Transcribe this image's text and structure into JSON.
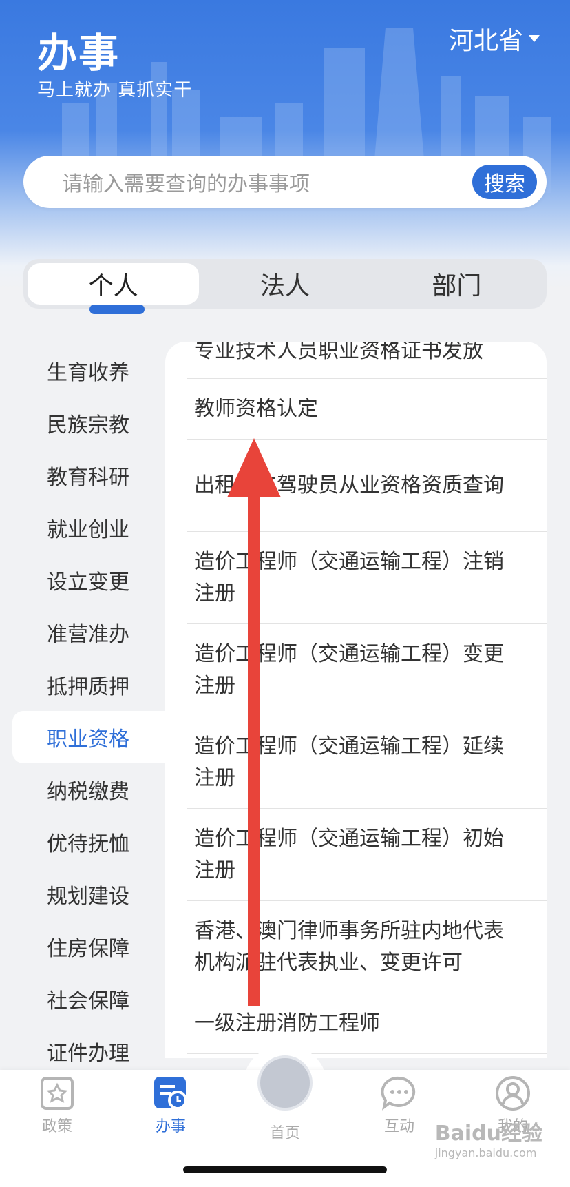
{
  "header": {
    "title": "办事",
    "slogan": "马上就办  真抓实干",
    "province": "河北省"
  },
  "search": {
    "placeholder": "请输入需要查询的办事事项",
    "button": "搜索"
  },
  "tabs": [
    {
      "label": "个人",
      "active": true
    },
    {
      "label": "法人",
      "active": false
    },
    {
      "label": "部门",
      "active": false
    }
  ],
  "sidebar": {
    "items": [
      {
        "label": "生育收养"
      },
      {
        "label": "民族宗教"
      },
      {
        "label": "教育科研"
      },
      {
        "label": "就业创业"
      },
      {
        "label": "设立变更"
      },
      {
        "label": "准营准办"
      },
      {
        "label": "抵押质押"
      },
      {
        "label": "职业资格",
        "active": true
      },
      {
        "label": "纳税缴费"
      },
      {
        "label": "优待抚恤"
      },
      {
        "label": "规划建设"
      },
      {
        "label": "住房保障"
      },
      {
        "label": "社会保障"
      },
      {
        "label": "证件办理"
      }
    ]
  },
  "content": {
    "items": [
      {
        "label": "专业技术人员职业资格证书发放"
      },
      {
        "label": "教师资格认定"
      },
      {
        "label": "出租汽车驾驶员从业资格资质查询"
      },
      {
        "label": "造价工程师（交通运输工程）注销注册"
      },
      {
        "label": "造价工程师（交通运输工程）变更注册"
      },
      {
        "label": "造价工程师（交通运输工程）延续注册"
      },
      {
        "label": "造价工程师（交通运输工程）初始注册"
      },
      {
        "label": "香港、澳门律师事务所驻内地代表机构派驻代表执业、变更许可"
      },
      {
        "label": "一级注册消防工程师"
      }
    ]
  },
  "tabbar": {
    "items": [
      {
        "label": "政策",
        "icon": "policy-icon"
      },
      {
        "label": "办事",
        "icon": "affairs-icon",
        "active": true
      },
      {
        "label": "首页",
        "icon": "home-emblem-icon"
      },
      {
        "label": "互动",
        "icon": "chat-icon"
      },
      {
        "label": "我的",
        "icon": "user-icon"
      }
    ]
  },
  "watermark": {
    "text": "Baidu经验",
    "sub": "jingyan.baidu.com"
  },
  "colors": {
    "accent": "#2f6fd8",
    "arrow": "#e8443a",
    "header": "#3a79e0"
  }
}
